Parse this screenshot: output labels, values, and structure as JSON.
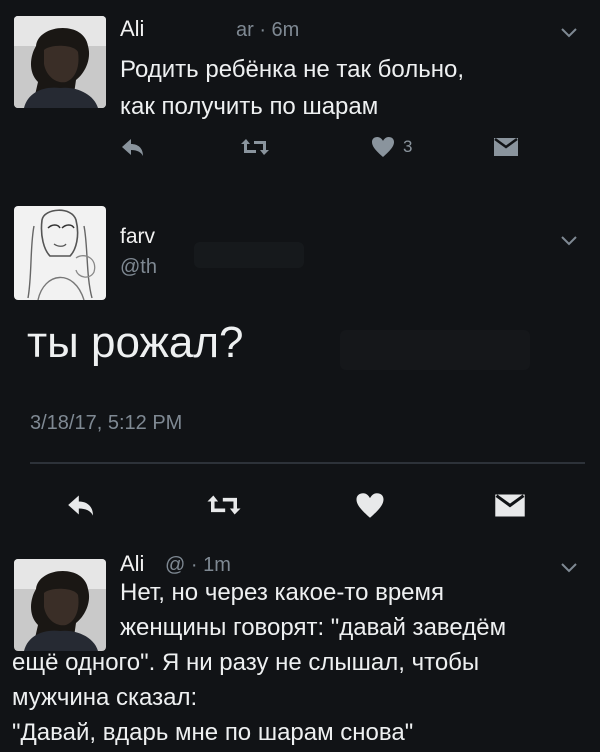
{
  "tweets": [
    {
      "name": "Ali",
      "meta": "ar · 6m",
      "text_lines": [
        "Родить ребёнка не так больно,",
        "как получить по шарам"
      ],
      "like_count": "3"
    },
    {
      "name": "farv",
      "handle": "@th",
      "text": "ты рожал?",
      "date": "3/18/17, 5:12 PM"
    },
    {
      "name": "Ali",
      "meta": "@ · 1m",
      "text_lines": [
        "Нет, но через какое-то время",
        "женщины говорят: \"давай заведём",
        "ещё одного\". Я ни разу не слышал, чтобы",
        "мужчина сказал:",
        "\"Давай, вдарь мне по шарам снова\""
      ]
    }
  ],
  "icons": {
    "reply": "reply-icon",
    "retweet": "retweet-icon",
    "like": "heart-icon",
    "message": "direct-message-icon",
    "more": "chevron-down-icon"
  },
  "colors": {
    "background": "#111316",
    "text": "#eef0f1",
    "muted": "#7f8993",
    "divider": "#2d3239"
  }
}
